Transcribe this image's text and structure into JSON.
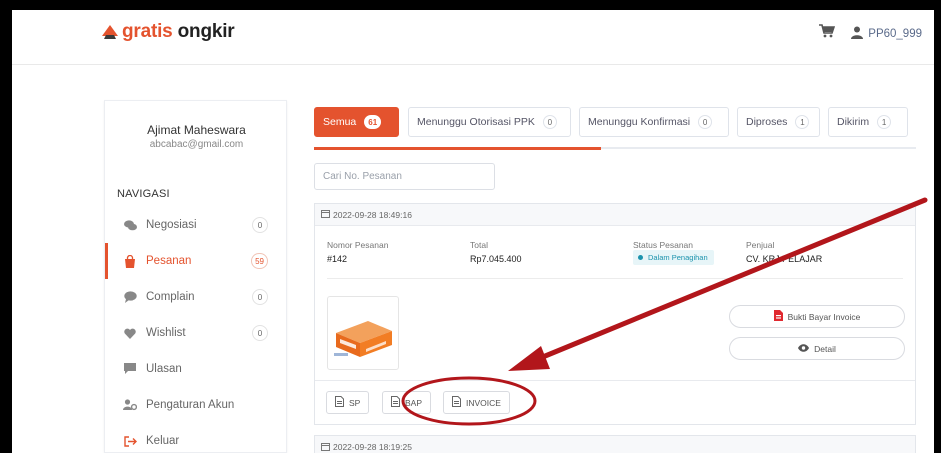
{
  "header": {
    "logo_prefix": "gratis",
    "logo_suffix": "ongkir",
    "username": "PP60_999",
    "icons": [
      "cart-icon",
      "user-icon"
    ]
  },
  "profile": {
    "name": "Ajimat Maheswara",
    "email": "abcabac@gmail.com"
  },
  "nav": {
    "title": "NAVIGASI",
    "items": [
      {
        "label": "Negosiasi",
        "count": "0",
        "icon": "chat-icon"
      },
      {
        "label": "Pesanan",
        "count": "59",
        "icon": "shopping-bag-icon",
        "active": true
      },
      {
        "label": "Complain",
        "count": "0",
        "icon": "comment-icon"
      },
      {
        "label": "Wishlist",
        "count": "0",
        "icon": "heart-icon"
      },
      {
        "label": "Ulasan",
        "icon": "message-square-icon"
      },
      {
        "label": "Pengaturan Akun",
        "icon": "user-settings-icon"
      },
      {
        "label": "Keluar",
        "icon": "logout-icon"
      }
    ]
  },
  "tabs": [
    {
      "label": "Semua",
      "count": "61",
      "active": true
    },
    {
      "label": "Menunggu Otorisasi PPK",
      "count": "0"
    },
    {
      "label": "Menunggu Konfirmasi",
      "count": "0"
    },
    {
      "label": "Diproses",
      "count": "1"
    },
    {
      "label": "Dikirim",
      "count": "1"
    }
  ],
  "search": {
    "placeholder": "Cari No. Pesanan",
    "value": ""
  },
  "order": {
    "date": "2022-09-28 18:49:16",
    "labels": {
      "number": "Nomor Pesanan",
      "total": "Total",
      "status": "Status Pesanan",
      "seller": "Penjual"
    },
    "number": "#142",
    "total": "Rp7.045.400",
    "status": "Dalam Penagihan",
    "seller": "CV. KRJ PELAJAR",
    "buttons": {
      "invoice_proof": "Bukti Bayar Invoice",
      "detail": "Detail"
    },
    "documents": [
      "SP",
      "BAP",
      "INVOICE"
    ]
  },
  "next_order": {
    "date": "2022-09-28 18:19:25"
  },
  "colors": {
    "accent": "#e4532e",
    "status": "#1c93ad",
    "annotation": "#b2161b"
  }
}
